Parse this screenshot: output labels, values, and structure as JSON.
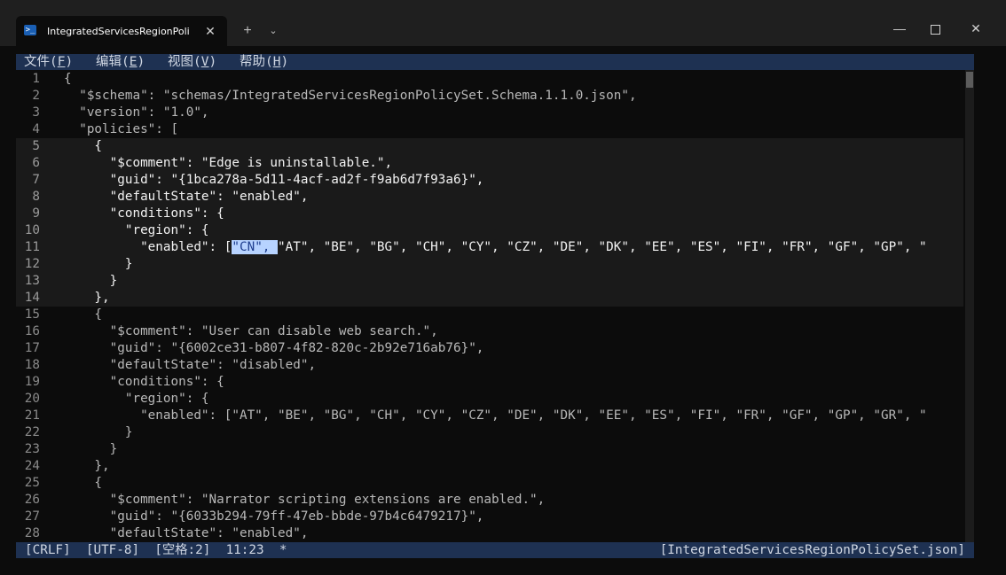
{
  "window": {
    "tab_title": "IntegratedServicesRegionPolicySet.json",
    "tab_icon": "powershell-icon",
    "new_tab": "+",
    "dropdown": "⌄",
    "minimize": "—",
    "close": "✕"
  },
  "menu": {
    "items": [
      {
        "label": "文件(",
        "key": "F",
        "end": ")"
      },
      {
        "label": "编辑(",
        "key": "E",
        "end": ")"
      },
      {
        "label": "视图(",
        "key": "V",
        "end": ")"
      },
      {
        "label": "帮助(",
        "key": "H",
        "end": ")"
      }
    ]
  },
  "editor": {
    "active_lines": [
      5,
      6,
      7,
      8,
      9,
      10,
      11,
      12,
      13,
      14
    ],
    "selection": {
      "line": 11,
      "text": "\"CN\", "
    },
    "lines": [
      {
        "n": "1",
        "text": "{"
      },
      {
        "n": "2",
        "text": "  \"$schema\": \"schemas/IntegratedServicesRegionPolicySet.Schema.1.1.0.json\","
      },
      {
        "n": "3",
        "text": "  \"version\": \"1.0\","
      },
      {
        "n": "4",
        "text": "  \"policies\": ["
      },
      {
        "n": "5",
        "text": "    {"
      },
      {
        "n": "6",
        "text": "      \"$comment\": \"Edge is uninstallable.\","
      },
      {
        "n": "7",
        "text": "      \"guid\": \"{1bca278a-5d11-4acf-ad2f-f9ab6d7f93a6}\","
      },
      {
        "n": "8",
        "text": "      \"defaultState\": \"enabled\","
      },
      {
        "n": "9",
        "text": "      \"conditions\": {"
      },
      {
        "n": "10",
        "text": "        \"region\": {"
      },
      {
        "n": "11",
        "before": "          \"enabled\": [",
        "sel": "\"CN\", ",
        "after": "\"AT\", \"BE\", \"BG\", \"CH\", \"CY\", \"CZ\", \"DE\", \"DK\", \"EE\", \"ES\", \"FI\", \"FR\", \"GF\", \"GP\", \""
      },
      {
        "n": "12",
        "text": "        }"
      },
      {
        "n": "13",
        "text": "      }"
      },
      {
        "n": "14",
        "text": "    },"
      },
      {
        "n": "15",
        "text": "    {"
      },
      {
        "n": "16",
        "text": "      \"$comment\": \"User can disable web search.\","
      },
      {
        "n": "17",
        "text": "      \"guid\": \"{6002ce31-b807-4f82-820c-2b92e716ab76}\","
      },
      {
        "n": "18",
        "text": "      \"defaultState\": \"disabled\","
      },
      {
        "n": "19",
        "text": "      \"conditions\": {"
      },
      {
        "n": "20",
        "text": "        \"region\": {"
      },
      {
        "n": "21",
        "text": "          \"enabled\": [\"AT\", \"BE\", \"BG\", \"CH\", \"CY\", \"CZ\", \"DE\", \"DK\", \"EE\", \"ES\", \"FI\", \"FR\", \"GF\", \"GP\", \"GR\", \""
      },
      {
        "n": "22",
        "text": "        }"
      },
      {
        "n": "23",
        "text": "      }"
      },
      {
        "n": "24",
        "text": "    },"
      },
      {
        "n": "25",
        "text": "    {"
      },
      {
        "n": "26",
        "text": "      \"$comment\": \"Narrator scripting extensions are enabled.\","
      },
      {
        "n": "27",
        "text": "      \"guid\": \"{6033b294-79ff-47eb-bbde-97b4c6479217}\","
      },
      {
        "n": "28",
        "text": "      \"defaultState\": \"enabled\","
      }
    ]
  },
  "status": {
    "left": "[CRLF]  [UTF-8]  [空格:2]  11:23  *",
    "right": "[IntegratedServicesRegionPolicySet.json]"
  },
  "colors": {
    "bar_background": "#1e3152",
    "selection_background": "#b7d3ff",
    "selection_text": "#1f3f8f",
    "window_background": "#0c0c0c"
  }
}
